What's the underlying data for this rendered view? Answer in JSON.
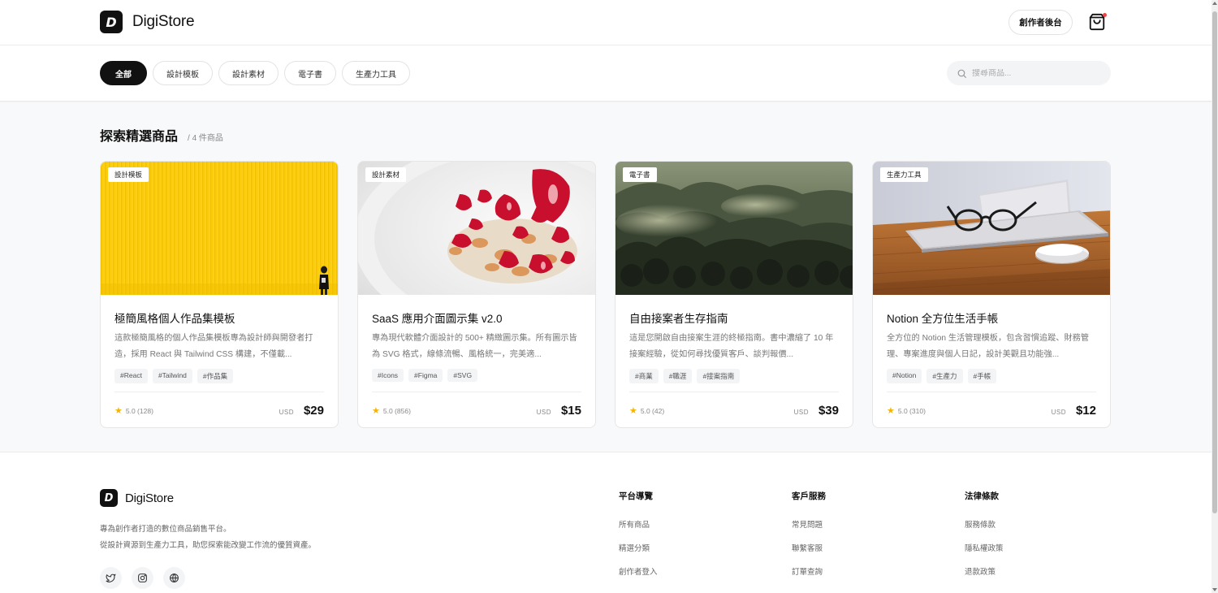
{
  "header": {
    "logo_letter": "D",
    "brand": "DigiStore",
    "creator_button": "創作者後台",
    "cart_icon": "shopping-bag-icon"
  },
  "filters": [
    {
      "label": "全部",
      "active": true
    },
    {
      "label": "設計模板",
      "active": false
    },
    {
      "label": "設計素材",
      "active": false
    },
    {
      "label": "電子書",
      "active": false
    },
    {
      "label": "生產力工具",
      "active": false
    }
  ],
  "search": {
    "placeholder": "搜尋商品...",
    "value": ""
  },
  "section": {
    "title": "探索精選商品",
    "count": "/ 4 件商品"
  },
  "products": [
    {
      "badge": "設計模板",
      "image": "yellow-wall-photo",
      "title": "極簡風格個人作品集模板",
      "desc": "這款極簡風格的個人作品集模板專為設計師與開發者打造，採用 React 與 Tailwind CSS 構建，不僅載...",
      "tags": [
        "#React",
        "#Tailwind",
        "#作品集"
      ],
      "rating": "5.0 (128)",
      "currency": "USD",
      "price": "$29"
    },
    {
      "badge": "設計素材",
      "image": "strawberry-bowl-photo",
      "title": "SaaS 應用介面圖示集 v2.0",
      "desc": "專為現代軟體介面設計的 500+ 精緻圖示集。所有圖示皆為 SVG 格式，線條流暢、風格統一，完美適...",
      "tags": [
        "#Icons",
        "#Figma",
        "#SVG"
      ],
      "rating": "5.0 (856)",
      "currency": "USD",
      "price": "$15"
    },
    {
      "badge": "電子書",
      "image": "misty-forest-photo",
      "title": "自由接案者生存指南",
      "desc": "這是您開啟自由接案生涯的終極指南。書中濃縮了 10 年接案經驗，從如何尋找優質客戶、談判報價...",
      "tags": [
        "#商業",
        "#職涯",
        "#接案指南"
      ],
      "rating": "5.0 (42)",
      "currency": "USD",
      "price": "$39"
    },
    {
      "badge": "生產力工具",
      "image": "laptop-desk-photo",
      "title": "Notion 全方位生活手帳",
      "desc": "全方位的 Notion 生活管理模板，包含習慣追蹤、財務管理、專案進度與個人日記，設計美觀且功能強...",
      "tags": [
        "#Notion",
        "#生產力",
        "#手帳"
      ],
      "rating": "5.0 (310)",
      "currency": "USD",
      "price": "$12"
    }
  ],
  "footer": {
    "brand": "DigiStore",
    "logo_letter": "D",
    "desc_line1": "專為創作者打造的數位商品銷售平台。",
    "desc_line2": "從設計資源到生產力工具，助您探索能改變工作流的優質資產。",
    "socials": [
      "twitter-icon",
      "instagram-icon",
      "globe-icon"
    ],
    "columns": [
      {
        "title": "平台導覽",
        "links": [
          "所有商品",
          "精選分類",
          "創作者登入"
        ]
      },
      {
        "title": "客戶服務",
        "links": [
          "常見問題",
          "聯繫客服",
          "訂單查詢"
        ]
      },
      {
        "title": "法律條款",
        "links": [
          "服務條款",
          "隱私權政策",
          "退款政策"
        ]
      }
    ]
  },
  "colors": {
    "accent": "#111111",
    "star": "#f4b400",
    "cart_dot": "#ef4444",
    "background": "#f8f9fb"
  }
}
